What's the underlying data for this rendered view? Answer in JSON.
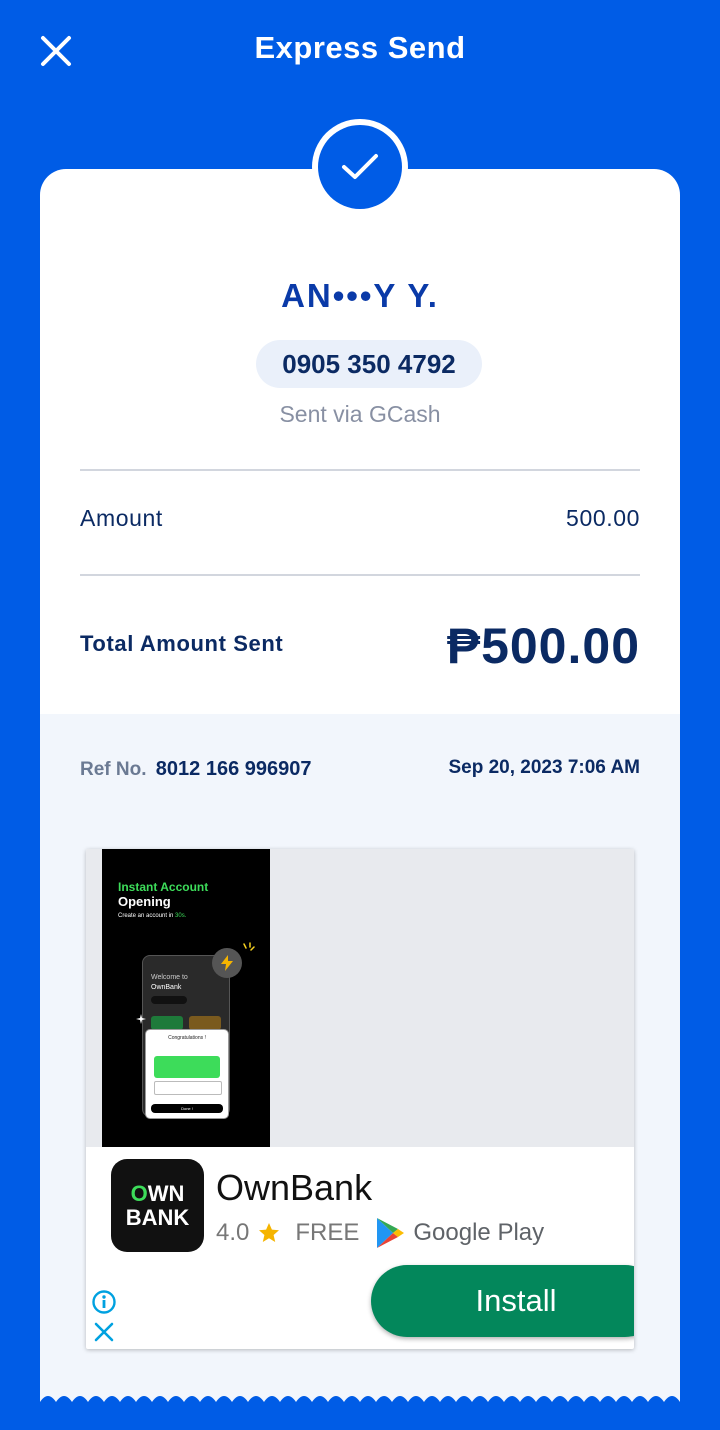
{
  "header": {
    "title": "Express Send",
    "close_icon": "close-icon"
  },
  "status_icon": "checkmark-icon",
  "recipient": {
    "name": "AN•••Y Y.",
    "phone": "0905 350 4792",
    "via": "Sent via GCash"
  },
  "amount_row": {
    "label": "Amount",
    "value": "500.00"
  },
  "total_row": {
    "label": "Total Amount Sent",
    "value": "₱500.00"
  },
  "reference": {
    "label": "Ref No.",
    "number": "8012 166 996907",
    "datetime": "Sep 20, 2023 7:06 AM"
  },
  "ad": {
    "banner": {
      "headline_1": "Instant Account",
      "headline_2": "Opening",
      "subtext_prefix": "Create an account in",
      "subtext_highlight": "30s.",
      "screen_text_1": "Welcome to",
      "screen_text_2": "OwnBank",
      "popup_title": "Congratulations !",
      "popup_button": "Done !"
    },
    "app_icon_text_1": "OWN",
    "app_icon_text_2": "BANK",
    "app_name": "OwnBank",
    "rating": "4.0",
    "price": "FREE",
    "store": "Google Play",
    "install_label": "Install",
    "info_icon": "info-icon",
    "close_icon": "close-icon"
  },
  "colors": {
    "brand_blue": "#005ce6",
    "navy": "#0b2a63",
    "install_green": "#03875b",
    "ad_green": "#3ddc5a"
  }
}
